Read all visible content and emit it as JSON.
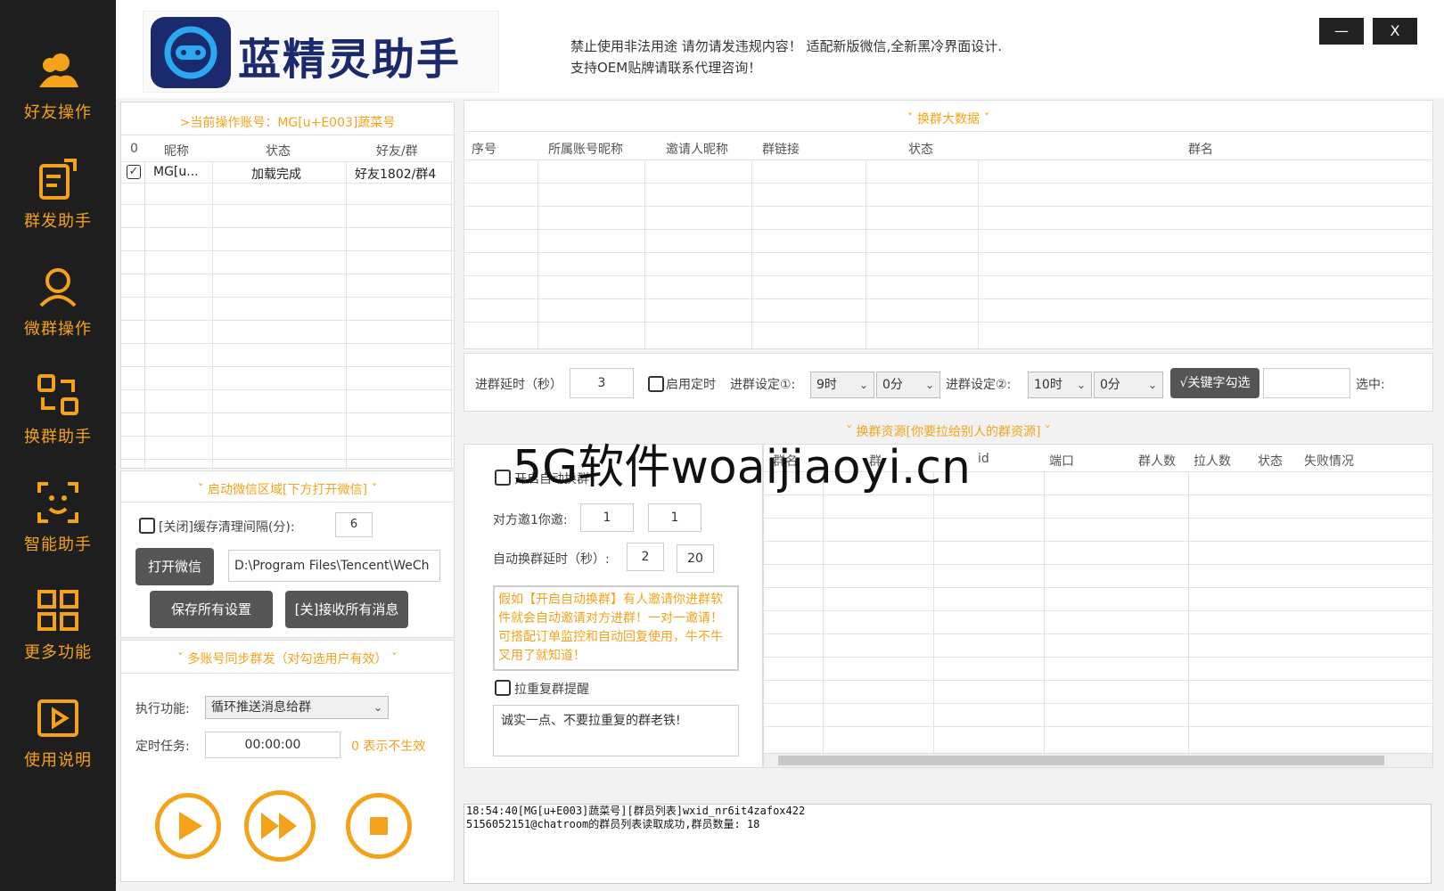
{
  "sidebar": {
    "items": [
      {
        "label": "好友操作",
        "icon": "friends-icon"
      },
      {
        "label": "群发助手",
        "icon": "mass-send-icon"
      },
      {
        "label": "微群操作",
        "icon": "group-user-icon"
      },
      {
        "label": "换群助手",
        "icon": "swap-group-icon"
      },
      {
        "label": "智能助手",
        "icon": "smart-face-icon"
      },
      {
        "label": "更多功能",
        "icon": "grid-icon"
      },
      {
        "label": "使用说明",
        "icon": "play-doc-icon"
      }
    ]
  },
  "header": {
    "logo_text": "蓝精灵助手",
    "notice_line1": "禁止使用非法用途 请勿请发违规内容！ 适配新版微信,全新黑冷界面设计.",
    "notice_line2": "支持OEM贴牌请联系代理咨询！",
    "min_label": "—",
    "close_label": "X"
  },
  "account_panel": {
    "title": ">当前操作账号：MG[u+E003]蔬菜号",
    "headers": [
      "0",
      "昵称",
      "状态",
      "好友/群"
    ],
    "rows": [
      {
        "checked": true,
        "nickname": "MG[u...",
        "status": "加载完成",
        "friends": "好友1802/群4"
      }
    ]
  },
  "wechat_panel": {
    "title": "ˇ 启动微信区域[下方打开微信] ˇ",
    "cache_label": "[关闭]缓存清理间隔(分):",
    "cache_value": "6",
    "open_button": "打开微信",
    "path_value": "D:\\Program Files\\Tencent\\WeCh",
    "save_button": "保存所有设置",
    "receive_button": "[关]接收所有消息"
  },
  "sync_panel": {
    "title": "ˇ 多账号同步群发（对勾选用户有效） ˇ",
    "exec_label": "执行功能:",
    "exec_value": "循环推送消息给群",
    "timer_label": "定时任务:",
    "timer_value": "00:00:00",
    "timer_hint": "0 表示不生效"
  },
  "group_data_panel": {
    "title": "ˇ 换群大数据 ˇ",
    "headers": [
      "序号",
      "所属账号昵称",
      "邀请人昵称",
      "群链接",
      "状态",
      "群名"
    ]
  },
  "settings_bar": {
    "delay_label": "进群延时（秒）",
    "delay_value": "3",
    "timer_label": "启用定时",
    "set1_label": "进群设定①:",
    "set1_hour": "9时",
    "set1_min": "0分",
    "set2_label": "进群设定②:",
    "set2_hour": "10时",
    "set2_min": "0分",
    "keyword_button": "√关键字勾选",
    "selected_label": "选中:"
  },
  "resource_panel": {
    "title": "ˇ 换群资源[你要拉给别人的群资源] ˇ",
    "auto_label": "开启自动换群",
    "ratio_label": "对方邀1你邀:",
    "ratio_a": "1",
    "ratio_b": "1",
    "auto_delay_label": "自动换群延时（秒）:",
    "auto_delay_a": "2",
    "auto_delay_b": "20",
    "tip_text": "假如【开启自动换群】有人邀请你进群软件就会自动邀请对方进群！一对一邀请！ 可搭配订单监控和自动回复使用，牛不牛叉用了就知道！",
    "dup_label": "拉重复群提醒",
    "dup_text": "诚实一点、不要拉重复的群老铁!",
    "headers": [
      "群名",
      "群",
      "id",
      "端口",
      "群人数",
      "拉人数",
      "状态",
      "失败情况"
    ]
  },
  "log": {
    "line1": "18:54:40[MG[u+E003]蔬菜号][群员列表]wxid_nr6it4zafox422",
    "line2": "5156052151@chatroom的群员列表读取成功,群员数量: 18"
  },
  "watermark": "5G软件woaijiaoyi.cn",
  "colors": {
    "accent": "#f5a21b",
    "sidebar_bg": "#1e1e1e",
    "brand": "#1a2a6c"
  }
}
